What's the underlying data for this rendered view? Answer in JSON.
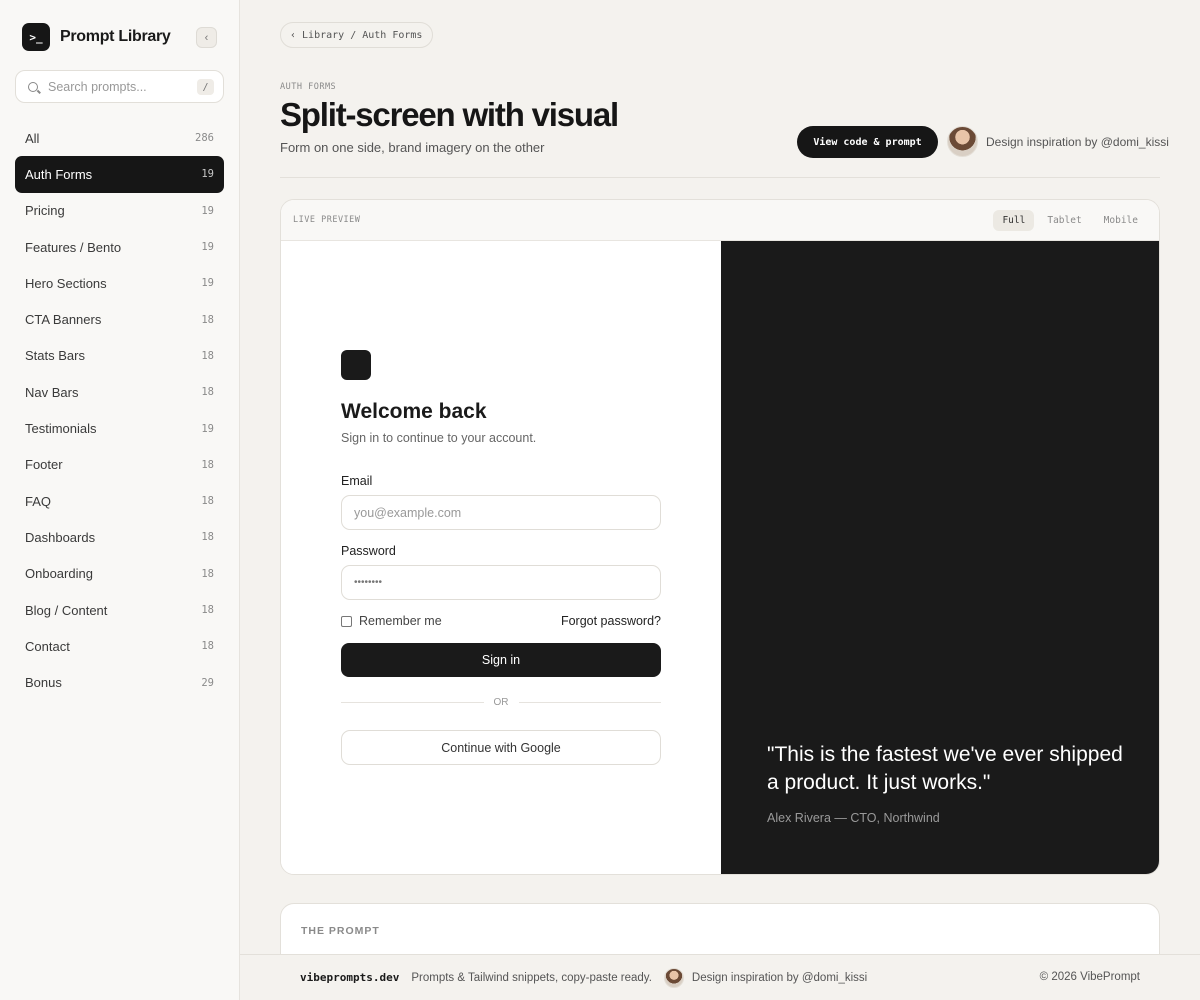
{
  "brand": {
    "name": "Prompt Library",
    "logo_glyph": ">_"
  },
  "search": {
    "placeholder": "Search prompts...",
    "shortcut": "/"
  },
  "nav": [
    {
      "label": "All",
      "count": "286",
      "active": false
    },
    {
      "label": "Auth Forms",
      "count": "19",
      "active": true
    },
    {
      "label": "Pricing",
      "count": "19",
      "active": false
    },
    {
      "label": "Features / Bento",
      "count": "19",
      "active": false
    },
    {
      "label": "Hero Sections",
      "count": "19",
      "active": false
    },
    {
      "label": "CTA Banners",
      "count": "18",
      "active": false
    },
    {
      "label": "Stats Bars",
      "count": "18",
      "active": false
    },
    {
      "label": "Nav Bars",
      "count": "18",
      "active": false
    },
    {
      "label": "Testimonials",
      "count": "19",
      "active": false
    },
    {
      "label": "Footer",
      "count": "18",
      "active": false
    },
    {
      "label": "FAQ",
      "count": "18",
      "active": false
    },
    {
      "label": "Dashboards",
      "count": "18",
      "active": false
    },
    {
      "label": "Onboarding",
      "count": "18",
      "active": false
    },
    {
      "label": "Blog / Content",
      "count": "18",
      "active": false
    },
    {
      "label": "Contact",
      "count": "18",
      "active": false
    },
    {
      "label": "Bonus",
      "count": "29",
      "active": false
    }
  ],
  "breadcrumb": {
    "text": "Library / Auth Forms"
  },
  "header": {
    "eyebrow": "AUTH FORMS",
    "title": "Split-screen with visual",
    "subtitle": "Form on one side, brand imagery on the other",
    "view_button": "View code & prompt",
    "credit": "Design inspiration by @domi_kissi"
  },
  "preview": {
    "label": "LIVE PREVIEW",
    "modes": [
      "Full",
      "Tablet",
      "Mobile"
    ],
    "active_mode": "Full",
    "form": {
      "title": "Welcome back",
      "subtitle": "Sign in to continue to your account.",
      "email_label": "Email",
      "email_placeholder": "you@example.com",
      "password_label": "Password",
      "password_value": "••••••••",
      "remember_label": "Remember me",
      "forgot_label": "Forgot password?",
      "signin_label": "Sign in",
      "or_label": "OR",
      "google_label": "Continue with Google"
    },
    "visual": {
      "quote": "\"This is the fastest we've ever shipped a product. It just works.\"",
      "author": "Alex Rivera — CTO, Northwind"
    }
  },
  "prompt": {
    "title": "THE PROMPT"
  },
  "footer": {
    "domain": "vibeprompts.dev",
    "tagline": "Prompts & Tailwind snippets, copy-paste ready.",
    "credit": "Design inspiration by @domi_kissi",
    "copyright": "© 2026 VibePrompt"
  }
}
